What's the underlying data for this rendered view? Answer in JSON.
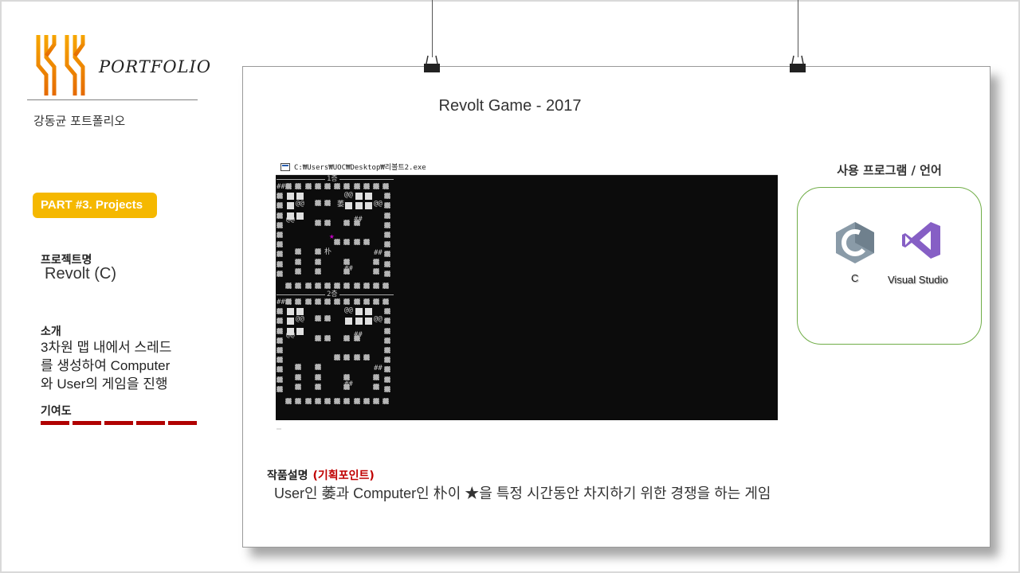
{
  "sidebar": {
    "logo_icon": "kk-logo-icon",
    "portfolio_word": "PORTFOLIO",
    "subtitle": "강동균 포트폴리오",
    "part_badge": "PART #3. Projects",
    "project_name_label": "프로젝트명",
    "project_name_value": "Revolt (C)",
    "intro_label": "소개",
    "intro_text": " 3차원 맵 내에서 스레드\n를 생성하여 Computer\n와 User의 게임을 진행",
    "contribution_label": "기여도",
    "contribution_level": 5,
    "accent_color": "#b00000",
    "badge_color": "#f5b800"
  },
  "main": {
    "title": "Revolt Game - 2017",
    "clip_icon": "binder-clip-icon",
    "console": {
      "icon": "console-window-icon",
      "path": "C:₩Users₩UOC₩Desktop₩리볼트2.exe",
      "floor1_label": "1층",
      "floor2_label": "2층",
      "star_glyph": "★",
      "user_glyph": "萎",
      "computer_glyph": "朴",
      "hash_glyph": "##",
      "at_glyph": "@@"
    },
    "program_heading": "사용 프로그램 / 언어",
    "tools": [
      {
        "label": "C",
        "icon": "c-language-icon"
      },
      {
        "label": "Visual Studio",
        "icon": "visual-studio-icon"
      }
    ],
    "program_border_color": "#70ad47",
    "description_label": "작품설명",
    "description_accent": "(기획포인트)",
    "description_text": "User인 萎과 Computer인 朴이 ★을 특정 시간동안 차지하기 위한 경쟁을 하는 게임"
  }
}
